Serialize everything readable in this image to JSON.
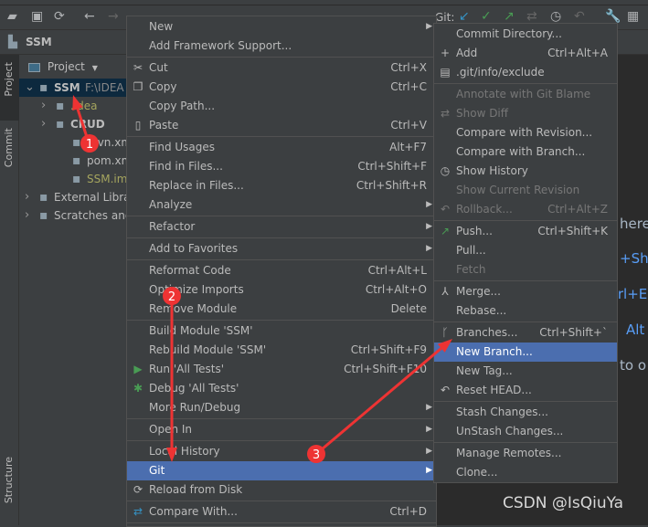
{
  "toolbar": {
    "git_label": "Git:"
  },
  "navbar": {
    "project_name": "SSM"
  },
  "stripe": {
    "project_tab": "Project",
    "commit_tab": "Commit",
    "structure_tab": "Structure"
  },
  "project_panel": {
    "header": "Project",
    "tree": [
      {
        "label": "SSM",
        "extra": "F:\\IDEA",
        "level": 0,
        "expanded": true,
        "bold": true,
        "color": "#bbbbbb",
        "selected": true,
        "icon": "module-folder-icon"
      },
      {
        "label": ".idea",
        "level": 1,
        "expanded": false,
        "color": "#a5a55e",
        "icon": "folder-icon"
      },
      {
        "label": "CRUD",
        "level": 1,
        "expanded": false,
        "bold": true,
        "color": "#bbbbbb",
        "icon": "module-folder-icon"
      },
      {
        "label": "mvn.xml",
        "level": 2,
        "color": "#bbbbbb",
        "icon": "xml-file-icon"
      },
      {
        "label": "pom.xml",
        "level": 2,
        "color": "#bbbbbb",
        "icon": "maven-icon"
      },
      {
        "label": "SSM.iml",
        "level": 2,
        "color": "#a5a55e",
        "icon": "iml-file-icon"
      },
      {
        "label": "External Libraries",
        "level": 0,
        "expanded": false,
        "color": "#bbbbbb",
        "icon": "library-icon"
      },
      {
        "label": "Scratches and Consoles",
        "level": 0,
        "expanded": false,
        "color": "#bbbbbb",
        "icon": "scratches-icon"
      }
    ]
  },
  "context_menu": {
    "items": [
      {
        "label": "New",
        "submenu": true
      },
      {
        "label": "Add Framework Support..."
      },
      {
        "sep": true
      },
      {
        "label": "Cut",
        "shortcut": "Ctrl+X",
        "icon": "scissors-icon",
        "glyph": "✂"
      },
      {
        "label": "Copy",
        "shortcut": "Ctrl+C",
        "icon": "copy-icon",
        "glyph": "❐"
      },
      {
        "label": "Copy Path..."
      },
      {
        "label": "Paste",
        "shortcut": "Ctrl+V",
        "icon": "clipboard-icon",
        "glyph": "▯"
      },
      {
        "sep": true
      },
      {
        "label": "Find Usages",
        "shortcut": "Alt+F7"
      },
      {
        "label": "Find in Files...",
        "shortcut": "Ctrl+Shift+F"
      },
      {
        "label": "Replace in Files...",
        "shortcut": "Ctrl+Shift+R"
      },
      {
        "label": "Analyze",
        "submenu": true
      },
      {
        "sep": true
      },
      {
        "label": "Refactor",
        "submenu": true
      },
      {
        "sep": true
      },
      {
        "label": "Add to Favorites",
        "submenu": true
      },
      {
        "sep": true
      },
      {
        "label": "Reformat Code",
        "shortcut": "Ctrl+Alt+L"
      },
      {
        "label": "Optimize Imports",
        "shortcut": "Ctrl+Alt+O"
      },
      {
        "label": "Remove Module",
        "shortcut": "Delete"
      },
      {
        "sep": true
      },
      {
        "label": "Build Module 'SSM'"
      },
      {
        "label": "Rebuild Module 'SSM'",
        "shortcut": "Ctrl+Shift+F9"
      },
      {
        "label": "Run 'All Tests'",
        "shortcut": "Ctrl+Shift+F10",
        "icon": "run-icon",
        "glyph": "▶",
        "glyph_color": "#499c54"
      },
      {
        "label": "Debug 'All Tests'",
        "icon": "debug-bug-icon",
        "glyph": "✱",
        "glyph_color": "#499c54"
      },
      {
        "label": "More Run/Debug",
        "submenu": true
      },
      {
        "sep": true
      },
      {
        "label": "Open In",
        "submenu": true
      },
      {
        "sep": true
      },
      {
        "label": "Local History",
        "submenu": true
      },
      {
        "label": "Git",
        "submenu": true,
        "selected": true
      },
      {
        "label": "Reload from Disk",
        "icon": "reload-icon",
        "glyph": "⟳"
      },
      {
        "sep": true
      },
      {
        "label": "Compare With...",
        "shortcut": "Ctrl+D",
        "icon": "compare-icon",
        "glyph": "⇄",
        "glyph_color": "#3592c4"
      },
      {
        "sep": true
      }
    ]
  },
  "git_submenu": {
    "items": [
      {
        "label": "Commit Directory..."
      },
      {
        "label": "Add",
        "shortcut": "Ctrl+Alt+A",
        "icon": "plus-icon",
        "glyph": "+"
      },
      {
        "label": ".git/info/exclude",
        "icon": "exclude-file-icon",
        "glyph": "▤"
      },
      {
        "sep": true
      },
      {
        "label": "Annotate with Git Blame",
        "disabled": true
      },
      {
        "label": "Show Diff",
        "disabled": true,
        "icon": "diff-icon",
        "glyph": "⇄"
      },
      {
        "label": "Compare with Revision..."
      },
      {
        "label": "Compare with Branch..."
      },
      {
        "label": "Show History",
        "icon": "clock-icon",
        "glyph": "◷"
      },
      {
        "label": "Show Current Revision",
        "disabled": true
      },
      {
        "label": "Rollback...",
        "shortcut": "Ctrl+Alt+Z",
        "disabled": true,
        "icon": "rollback-icon",
        "glyph": "↶"
      },
      {
        "sep": true
      },
      {
        "label": "Push...",
        "shortcut": "Ctrl+Shift+K",
        "icon": "push-arrow-icon",
        "glyph": "↗",
        "glyph_color": "#499c54"
      },
      {
        "label": "Pull..."
      },
      {
        "label": "Fetch",
        "disabled": true
      },
      {
        "sep": true
      },
      {
        "label": "Merge...",
        "icon": "merge-icon",
        "glyph": "⅄"
      },
      {
        "label": "Rebase..."
      },
      {
        "sep": true
      },
      {
        "label": "Branches...",
        "shortcut": "Ctrl+Shift+`",
        "icon": "branch-icon",
        "glyph": "ᚴ"
      },
      {
        "label": "New Branch...",
        "selected": true
      },
      {
        "label": "New Tag..."
      },
      {
        "label": "Reset HEAD...",
        "icon": "reset-icon",
        "glyph": "↶"
      },
      {
        "sep": true
      },
      {
        "label": "Stash Changes..."
      },
      {
        "label": "UnStash Changes..."
      },
      {
        "sep": true
      },
      {
        "label": "Manage Remotes..."
      },
      {
        "label": "Clone..."
      }
    ]
  },
  "editor": {
    "fragments": [
      {
        "text": "here",
        "color": "#a9b7c6"
      },
      {
        "text": "+Shi",
        "color": "#589df6"
      },
      {
        "text": "trl+E",
        "color": "#589df6"
      },
      {
        "text": "Alt",
        "color": "#589df6"
      },
      {
        "text": "to o",
        "color": "#a9b7c6"
      }
    ]
  },
  "annotations": {
    "markers": [
      "1",
      "2",
      "3"
    ],
    "color": "#ee3333"
  },
  "watermark": "CSDN @IsQiuYa",
  "colors": {
    "menu_bg": "#3c3f41",
    "highlight": "#4b6eaf",
    "editor_bg": "#2b2b2b",
    "disabled": "#777777"
  }
}
